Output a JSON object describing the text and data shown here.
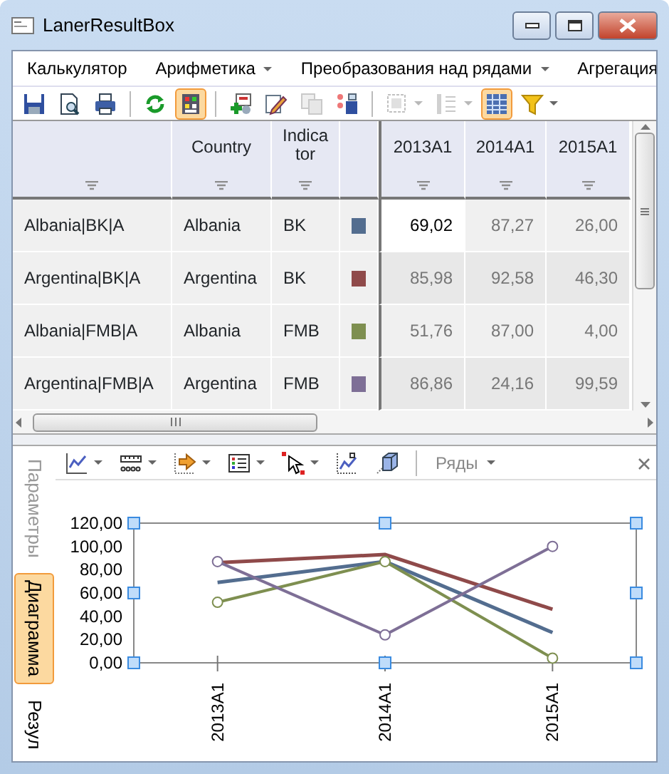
{
  "window": {
    "title": "LanerResultBox"
  },
  "menu": [
    {
      "label": "Калькулятор",
      "dropdown": false
    },
    {
      "label": "Арифметика",
      "dropdown": true
    },
    {
      "label": "Преобразования над рядами",
      "dropdown": true
    },
    {
      "label": "Агрегация",
      "dropdown": false
    }
  ],
  "toolbar": [
    {
      "kind": "button",
      "pressed": false,
      "disabled": false,
      "dropdown": false
    },
    {
      "kind": "button",
      "pressed": false,
      "disabled": false,
      "dropdown": false
    },
    {
      "kind": "button",
      "pressed": false,
      "disabled": false,
      "dropdown": false
    },
    {
      "kind": "separator"
    },
    {
      "kind": "button",
      "pressed": false,
      "disabled": false,
      "dropdown": false
    },
    {
      "kind": "button",
      "pressed": true,
      "disabled": false,
      "dropdown": false
    },
    {
      "kind": "separator"
    },
    {
      "kind": "button",
      "pressed": false,
      "disabled": false,
      "dropdown": false
    },
    {
      "kind": "button",
      "pressed": false,
      "disabled": false,
      "dropdown": false
    },
    {
      "kind": "button",
      "pressed": false,
      "disabled": true,
      "dropdown": false
    },
    {
      "kind": "button",
      "pressed": false,
      "disabled": false,
      "dropdown": false
    },
    {
      "kind": "separator"
    },
    {
      "kind": "button",
      "pressed": false,
      "disabled": true,
      "dropdown": true
    },
    {
      "kind": "button",
      "pressed": false,
      "disabled": true,
      "dropdown": true
    },
    {
      "kind": "button",
      "pressed": true,
      "disabled": false,
      "dropdown": false
    },
    {
      "kind": "button",
      "pressed": false,
      "disabled": false,
      "dropdown": true
    }
  ],
  "table": {
    "columns": [
      {
        "filter": true
      },
      {
        "label": "Country",
        "filter": true
      },
      {
        "label": "Indica tor",
        "filter": true
      },
      {
        "filter": false
      },
      {
        "label": "2013A1",
        "filter": true
      },
      {
        "label": "2014A1",
        "filter": true
      },
      {
        "label": "2015A1",
        "filter": true
      }
    ],
    "rows": [
      {
        "name": "Albania|BK|A",
        "country": "Albania",
        "indicator": "BK",
        "color": "#536d8f",
        "values": [
          {
            "text": "69,02",
            "selected": true
          },
          {
            "text": "87,27",
            "selected": false
          },
          {
            "text": "26,00",
            "selected": false
          }
        ]
      },
      {
        "name": "Argentina|BK|A",
        "country": "Argentina",
        "indicator": "BK",
        "color": "#8f4a4a",
        "values": [
          {
            "text": "85,98",
            "selected": false
          },
          {
            "text": "92,58",
            "selected": false
          },
          {
            "text": "46,30",
            "selected": false
          }
        ]
      },
      {
        "name": "Albania|FMB|A",
        "country": "Albania",
        "indicator": "FMB",
        "color": "#7e8f50",
        "values": [
          {
            "text": "51,76",
            "selected": false
          },
          {
            "text": "87,00",
            "selected": false
          },
          {
            "text": "4,00",
            "selected": false
          }
        ]
      },
      {
        "name": "Argentina|FMB|A",
        "country": "Argentina",
        "indicator": "FMB",
        "color": "#7e6f96",
        "values": [
          {
            "text": "86,86",
            "selected": false
          },
          {
            "text": "24,16",
            "selected": false
          },
          {
            "text": "99,59",
            "selected": false
          }
        ]
      }
    ]
  },
  "side_tabs": [
    {
      "label": "Параметры",
      "selected": false
    },
    {
      "label": "Диаграмма",
      "selected": true
    },
    {
      "label": "Резул",
      "selected": false
    }
  ],
  "chart_toolbar": [
    {
      "kind": "button",
      "dropdown": true
    },
    {
      "kind": "button",
      "dropdown": true
    },
    {
      "kind": "button",
      "dropdown": true
    },
    {
      "kind": "button",
      "dropdown": true
    },
    {
      "kind": "button",
      "dropdown": true
    },
    {
      "kind": "button",
      "dropdown": false
    },
    {
      "kind": "button",
      "dropdown": false
    },
    {
      "kind": "separator"
    },
    {
      "kind": "text",
      "label": "Ряды",
      "dropdown": true,
      "disabled": true
    }
  ],
  "chart": {
    "chart_data": {
      "type": "line",
      "categories": [
        "2013A1",
        "2014A1",
        "2015A1"
      ],
      "ylim": [
        0,
        120
      ],
      "yticks": [
        {
          "value": 0,
          "label": "0,00"
        },
        {
          "value": 20,
          "label": "20,00"
        },
        {
          "value": 40,
          "label": "40,00"
        },
        {
          "value": 60,
          "label": "60,00"
        },
        {
          "value": 80,
          "label": "80,00"
        },
        {
          "value": 100,
          "label": "100,00"
        },
        {
          "value": 120,
          "label": "120,00"
        }
      ],
      "series": [
        {
          "color": "#536d8f",
          "values": [
            69,
            87,
            26
          ]
        },
        {
          "color": "#8f4a4a",
          "values": [
            86,
            93,
            46
          ]
        },
        {
          "color": "#7e8f50",
          "values": [
            52,
            87,
            4
          ],
          "marker": "circle"
        },
        {
          "color": "#7e6f96",
          "values": [
            87,
            24,
            100
          ],
          "marker": "circle"
        }
      ]
    }
  }
}
